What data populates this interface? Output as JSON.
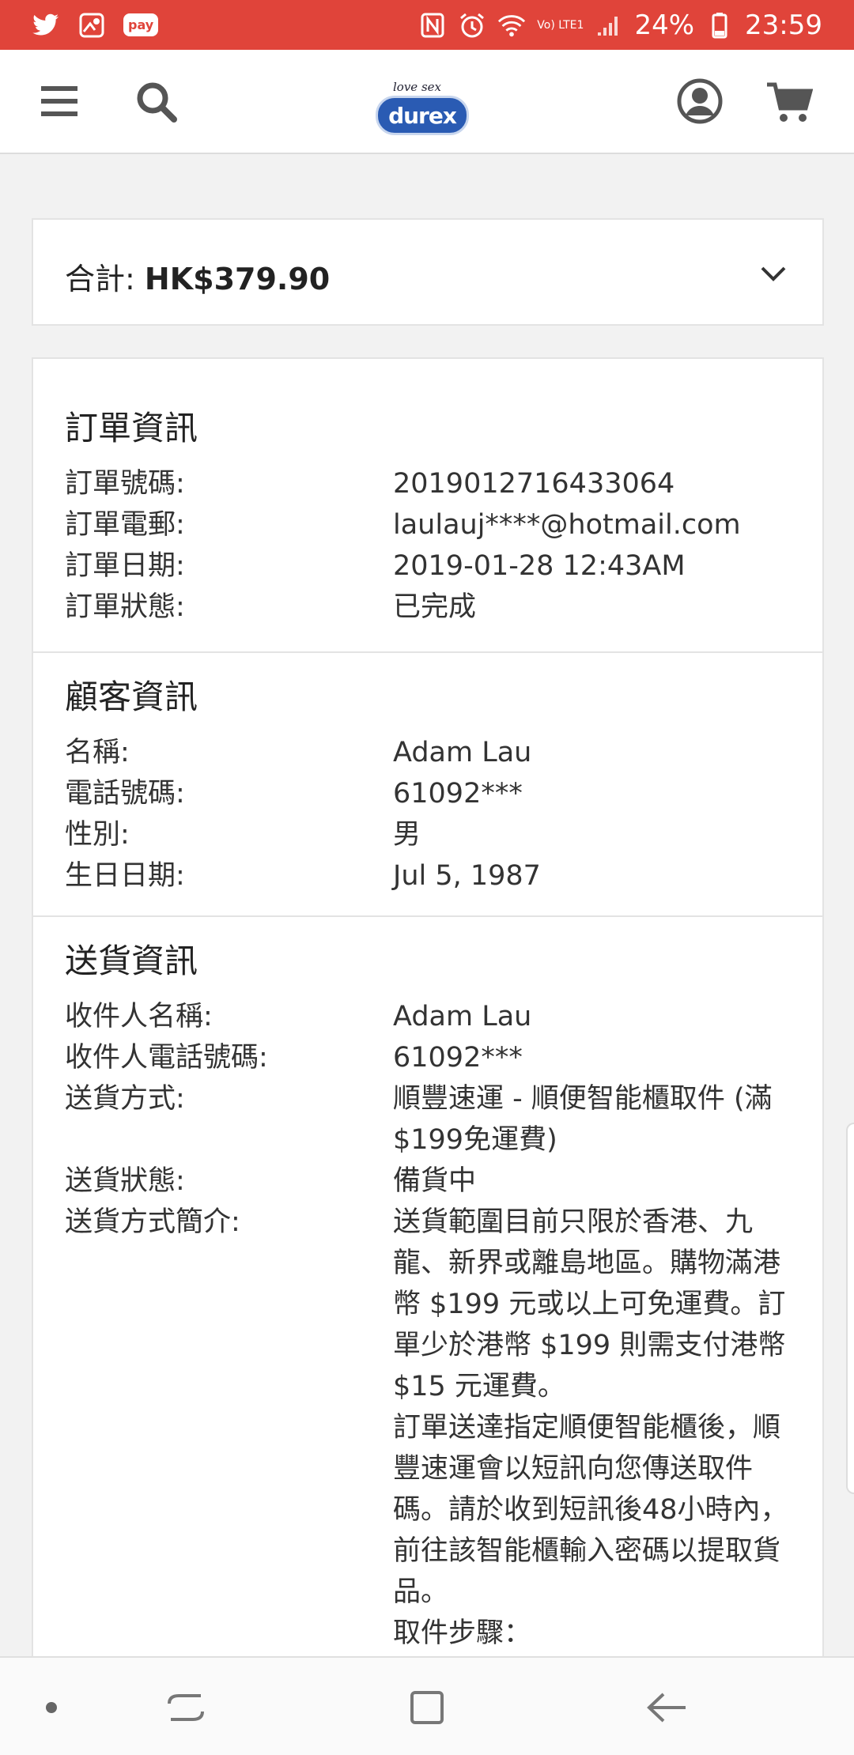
{
  "status_bar": {
    "battery": "24%",
    "time": "23:59",
    "pay_label": "pay",
    "network_label": "Vo) LTE1",
    "accent_color": "#e0443a"
  },
  "header": {
    "logo_tagline": "love sex",
    "logo_text": "durex",
    "icons": [
      "menu-icon",
      "search-icon",
      "account-icon",
      "cart-icon"
    ]
  },
  "summary": {
    "label": "合計: ",
    "amount": "HK$379.90"
  },
  "order_info": {
    "title": "訂單資訊",
    "rows": [
      {
        "label": "訂單號碼:",
        "value": "2019012716433064"
      },
      {
        "label": "訂單電郵:",
        "value": "laulauj****@hotmail.com"
      },
      {
        "label": "訂單日期:",
        "value": "2019-01-28 12:43AM"
      },
      {
        "label": "訂單狀態:",
        "value": "已完成"
      }
    ]
  },
  "customer_info": {
    "title": "顧客資訊",
    "rows": [
      {
        "label": "名稱:",
        "value": "Adam Lau"
      },
      {
        "label": "電話號碼:",
        "value": "61092***"
      },
      {
        "label": "性別:",
        "value": "男"
      },
      {
        "label": "生日日期:",
        "value": "Jul 5, 1987"
      }
    ]
  },
  "delivery_info": {
    "title": "送貨資訊",
    "rows": [
      {
        "label": "收件人名稱:",
        "value": "Adam Lau"
      },
      {
        "label": "收件人電話號碼:",
        "value": "61092***"
      },
      {
        "label": "送貨方式:",
        "value": "順豐速運 - 順便智能櫃取件 (滿$199免運費)"
      },
      {
        "label": "送貨狀態:",
        "value": "備貨中"
      },
      {
        "label": "送貨方式簡介:",
        "value": "送貨範圍目前只限於香港、九龍、新界或離島地區。購物滿港幣 $199 元或以上可免運費。訂單少於港幣 $199 則需支付港幣 $15 元運費。"
      }
    ],
    "extra_paragraphs": [
      "訂單送達指定順便智能櫃後，順豐速運會以短訊向您傳送取件碼。請於收到短訊後48小時內，前往該智能櫃輸入密碼以提取貨品。",
      "取件步驟："
    ]
  },
  "nav_bar": {
    "icons": [
      "recent-apps-icon",
      "home-icon",
      "back-icon"
    ]
  }
}
